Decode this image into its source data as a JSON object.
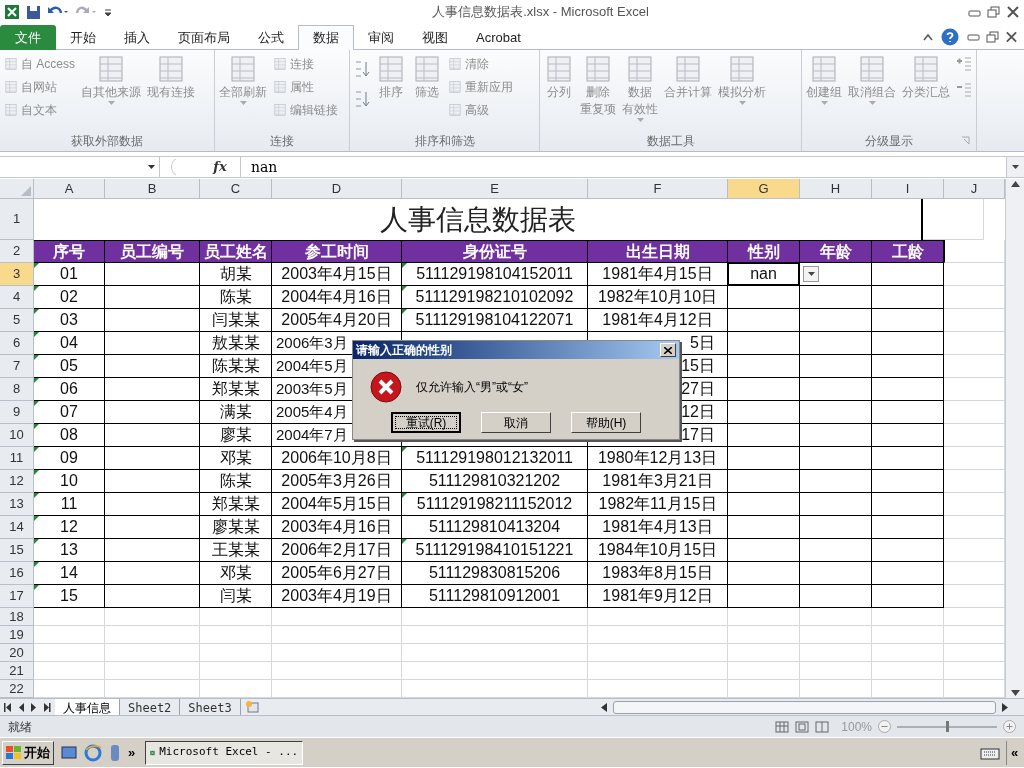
{
  "title_bar": {
    "title": "人事信息数据表.xlsx - Microsoft Excel"
  },
  "ribbon_tabs": [
    {
      "label": "文件",
      "kind": "file",
      "selected": false
    },
    {
      "label": "开始",
      "kind": "tab",
      "selected": false
    },
    {
      "label": "插入",
      "kind": "tab",
      "selected": false
    },
    {
      "label": "页面布局",
      "kind": "tab",
      "selected": false
    },
    {
      "label": "公式",
      "kind": "tab",
      "selected": false
    },
    {
      "label": "数据",
      "kind": "tab",
      "selected": true
    },
    {
      "label": "审阅",
      "kind": "tab",
      "selected": false
    },
    {
      "label": "视图",
      "kind": "tab",
      "selected": false
    },
    {
      "label": "Acrobat",
      "kind": "tab",
      "selected": false
    }
  ],
  "ribbon_groups": [
    {
      "label": "获取外部数据",
      "launcher": false,
      "items": [
        {
          "kind": "stack",
          "items": [
            {
              "label": "自 Access"
            },
            {
              "label": "自网站"
            },
            {
              "label": "自文本"
            }
          ]
        },
        {
          "kind": "large",
          "label": "自其他来源",
          "dropdown": true
        },
        {
          "kind": "large",
          "label": "现有连接",
          "dropdown": false
        }
      ]
    },
    {
      "label": "连接",
      "launcher": false,
      "items": [
        {
          "kind": "large",
          "label": "全部刷新",
          "dropdown": true
        },
        {
          "kind": "stack",
          "items": [
            {
              "label": "连接"
            },
            {
              "label": "属性"
            },
            {
              "label": "编辑链接"
            }
          ]
        }
      ]
    },
    {
      "label": "排序和筛选",
      "launcher": false,
      "items": [
        {
          "kind": "sort"
        },
        {
          "kind": "large",
          "label": "排序",
          "dropdown": false
        },
        {
          "kind": "large",
          "label": "筛选",
          "dropdown": false
        },
        {
          "kind": "stack",
          "items": [
            {
              "label": "清除"
            },
            {
              "label": "重新应用"
            },
            {
              "label": "高级"
            }
          ]
        }
      ]
    },
    {
      "label": "数据工具",
      "launcher": false,
      "items": [
        {
          "kind": "large",
          "label": "分列",
          "dropdown": false
        },
        {
          "kind": "large",
          "lines": [
            "删除",
            "重复项"
          ],
          "dropdown": false
        },
        {
          "kind": "large",
          "lines": [
            "数据",
            "有效性"
          ],
          "dropdown": true
        },
        {
          "kind": "large",
          "label": "合并计算",
          "dropdown": false
        },
        {
          "kind": "large",
          "label": "模拟分析",
          "dropdown": true
        }
      ]
    },
    {
      "label": "分级显示",
      "launcher": true,
      "items": [
        {
          "kind": "large",
          "label": "创建组",
          "dropdown": true
        },
        {
          "kind": "large",
          "label": "取消组合",
          "dropdown": true
        },
        {
          "kind": "large",
          "label": "分类汇总",
          "dropdown": false
        },
        {
          "kind": "detail"
        }
      ]
    }
  ],
  "formula_bar": {
    "function_label": "fx",
    "value": "nan"
  },
  "sheet": {
    "columns": [
      {
        "label": "A",
        "selected": false
      },
      {
        "label": "B",
        "selected": false
      },
      {
        "label": "C",
        "selected": false
      },
      {
        "label": "D",
        "selected": false
      },
      {
        "label": "E",
        "selected": false
      },
      {
        "label": "F",
        "selected": false
      },
      {
        "label": "G",
        "selected": true
      },
      {
        "label": "H",
        "selected": false
      },
      {
        "label": "I",
        "selected": false
      },
      {
        "label": "J",
        "selected": false
      }
    ],
    "title_row": {
      "number": "1",
      "text": "人事信息数据表"
    },
    "header_row": {
      "number": "2",
      "headers": [
        "序号",
        "员工编号",
        "员工姓名",
        "参工时间",
        "身份证号",
        "出生日期",
        "性别",
        "年龄",
        "工龄"
      ]
    },
    "rows": [
      {
        "number": "3",
        "selected": true,
        "cells": [
          {
            "text": "01",
            "flag": true
          },
          {},
          {
            "text": "胡某"
          },
          {
            "text": "2003年4月15日"
          },
          {
            "text": "511129198104152011",
            "flag": true
          },
          {
            "text": "1981年4月15日"
          },
          {
            "text": "nan",
            "dropdown": true
          },
          {},
          {}
        ]
      },
      {
        "number": "4",
        "selected": false,
        "cells": [
          {
            "text": "02",
            "flag": true
          },
          {},
          {
            "text": "陈某"
          },
          {
            "text": "2004年4月16日"
          },
          {
            "text": "511129198210102092",
            "flag": true
          },
          {
            "text": "1982年10月10日"
          },
          {},
          {},
          {}
        ]
      },
      {
        "number": "5",
        "selected": false,
        "cells": [
          {
            "text": "03",
            "flag": true
          },
          {},
          {
            "text": "闫某某"
          },
          {
            "text": "2005年4月20日"
          },
          {
            "text": "511129198104122071",
            "flag": true
          },
          {
            "text": "1981年4月12日"
          },
          {},
          {},
          {}
        ]
      },
      {
        "number": "6",
        "selected": false,
        "cells": [
          {
            "text": "04",
            "flag": true
          },
          {},
          {
            "text": "敖某某"
          },
          {
            "text": "2006年3月",
            "covered": true
          },
          {},
          {
            "text": "5日",
            "covered": true
          },
          {},
          {},
          {}
        ]
      },
      {
        "number": "7",
        "selected": false,
        "cells": [
          {
            "text": "05",
            "flag": true
          },
          {},
          {
            "text": "陈某某"
          },
          {
            "text": "2004年5月",
            "covered": true
          },
          {},
          {
            "text": "15日",
            "covered": true
          },
          {},
          {},
          {}
        ]
      },
      {
        "number": "8",
        "selected": false,
        "cells": [
          {
            "text": "06",
            "flag": true
          },
          {},
          {
            "text": "郑某某"
          },
          {
            "text": "2003年5月",
            "covered": true
          },
          {},
          {
            "text": "27日",
            "covered": true
          },
          {},
          {},
          {}
        ]
      },
      {
        "number": "9",
        "selected": false,
        "cells": [
          {
            "text": "07",
            "flag": true
          },
          {},
          {
            "text": "满某"
          },
          {
            "text": "2005年4月",
            "covered": true
          },
          {},
          {
            "text": "12日",
            "covered": true
          },
          {},
          {},
          {}
        ]
      },
      {
        "number": "10",
        "selected": false,
        "cells": [
          {
            "text": "08",
            "flag": true
          },
          {},
          {
            "text": "廖某"
          },
          {
            "text": "2004年7月",
            "covered": true
          },
          {},
          {
            "text": "17日",
            "covered": true
          },
          {},
          {},
          {}
        ]
      },
      {
        "number": "11",
        "selected": false,
        "cells": [
          {
            "text": "09",
            "flag": true
          },
          {},
          {
            "text": "邓某"
          },
          {
            "text": "2006年10月8日"
          },
          {
            "text": "511129198012132011",
            "flag": true
          },
          {
            "text": "1980年12月13日"
          },
          {},
          {},
          {}
        ]
      },
      {
        "number": "12",
        "selected": false,
        "cells": [
          {
            "text": "10",
            "flag": true
          },
          {},
          {
            "text": "陈某"
          },
          {
            "text": "2005年3月26日"
          },
          {
            "text": "511129810321202"
          },
          {
            "text": "1981年3月21日"
          },
          {},
          {},
          {}
        ]
      },
      {
        "number": "13",
        "selected": false,
        "cells": [
          {
            "text": "11",
            "flag": true
          },
          {},
          {
            "text": "郑某某"
          },
          {
            "text": "2004年5月15日"
          },
          {
            "text": "511129198211152012",
            "flag": true
          },
          {
            "text": "1982年11月15日"
          },
          {},
          {},
          {}
        ]
      },
      {
        "number": "14",
        "selected": false,
        "cells": [
          {
            "text": "12",
            "flag": true
          },
          {},
          {
            "text": "廖某某"
          },
          {
            "text": "2003年4月16日"
          },
          {
            "text": "511129810413204"
          },
          {
            "text": "1981年4月13日"
          },
          {},
          {},
          {}
        ]
      },
      {
        "number": "15",
        "selected": false,
        "cells": [
          {
            "text": "13",
            "flag": true
          },
          {},
          {
            "text": "王某某"
          },
          {
            "text": "2006年2月17日"
          },
          {
            "text": "511129198410151221",
            "flag": true
          },
          {
            "text": "1984年10月15日"
          },
          {},
          {},
          {}
        ]
      },
      {
        "number": "16",
        "selected": false,
        "cells": [
          {
            "text": "14",
            "flag": true
          },
          {},
          {
            "text": "邓某"
          },
          {
            "text": "2005年6月27日"
          },
          {
            "text": "511129830815206"
          },
          {
            "text": "1983年8月15日"
          },
          {},
          {},
          {}
        ]
      },
      {
        "number": "17",
        "selected": false,
        "cells": [
          {
            "text": "15",
            "flag": true
          },
          {},
          {
            "text": "闫某"
          },
          {
            "text": "2003年4月19日"
          },
          {
            "text": "511129810912001"
          },
          {
            "text": "1981年9月12日"
          },
          {},
          {},
          {}
        ]
      }
    ],
    "empty_rows": [
      "18",
      "19",
      "20",
      "21",
      "22"
    ]
  },
  "dialog": {
    "title": "请输入正确的性别",
    "message": "仅允许输入“男”或“女”",
    "buttons": [
      {
        "label": "重试(R)",
        "focused": true
      },
      {
        "label": "取消",
        "focused": false
      },
      {
        "label": "帮助(H)",
        "focused": false
      }
    ]
  },
  "sheet_tabs": [
    {
      "label": "人事信息",
      "selected": true
    },
    {
      "label": "Sheet2",
      "selected": false
    },
    {
      "label": "Sheet3",
      "selected": false
    }
  ],
  "status_bar": {
    "status": "就绪",
    "zoom": {
      "reading": "100%",
      "level": 0.5
    }
  },
  "taskbar": {
    "start": "开始",
    "more": "»",
    "window": "Microsoft Excel - ...",
    "tray_toggle": "«"
  }
}
